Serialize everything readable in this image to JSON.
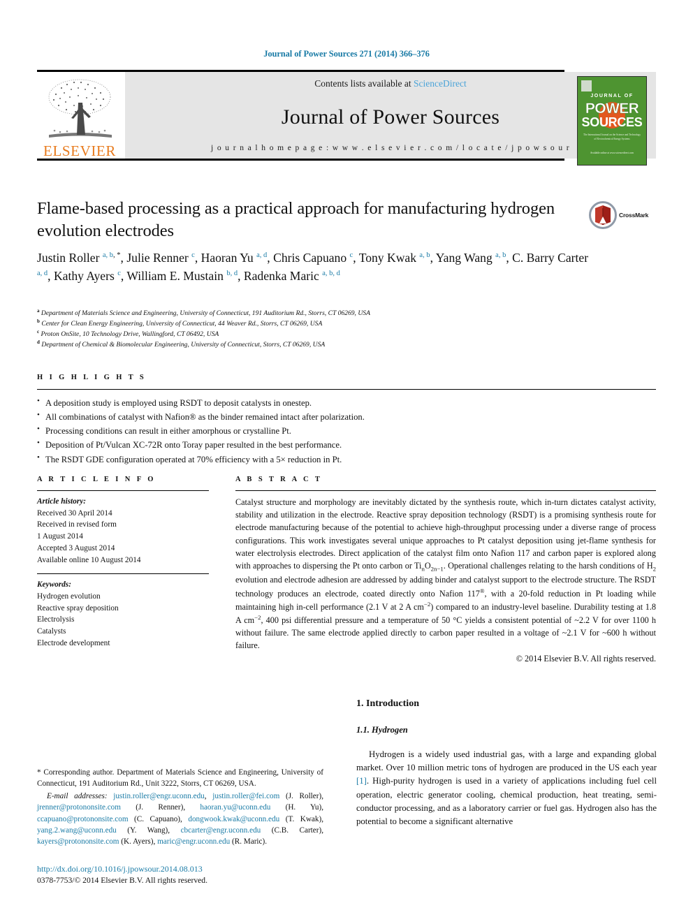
{
  "running_head": "Journal of Power Sources 271 (2014) 366–376",
  "masthead": {
    "contents_prefix": "Contents lists available at ",
    "sciencedirect": "ScienceDirect",
    "journal_title": "Journal of Power Sources",
    "homepage": "j o u r n a l   h o m e p a g e :   w w w . e l s e v i e r . c o m / l o c a t e / j p o w s o u r",
    "elsevier_wordmark": "ELSEVIER",
    "cover": {
      "journal_of": "JOURNAL OF",
      "power": "POWER",
      "sources": "SOURCES",
      "blurb": "The International Journal on the Science and Technology of Electrochemical Energy Systems",
      "editors": "Available online at www.sciencedirect.com"
    },
    "colors": {
      "link_blue": "#4aa3d8",
      "elsevier_orange": "#E87B1E",
      "cover_green": "#4e9431",
      "cover_orange": "#e2571f",
      "box_gray": "#e5e5e5"
    }
  },
  "article": {
    "title": "Flame-based processing as a practical approach for manufacturing hydrogen evolution electrodes",
    "crossmark_label": "CrossMark",
    "authors_html": "Justin Roller <sup>a, b</sup><sup class=\"star\">, *</sup>, Julie Renner <sup>c</sup>, Haoran Yu <sup>a, d</sup>, Chris Capuano <sup>c</sup>, Tony Kwak <sup>a, b</sup>, Yang Wang <sup>a, b</sup>, C. Barry Carter <sup>a, d</sup>, Kathy Ayers <sup>c</sup>, William E. Mustain <sup>b, d</sup>, Radenka Maric <sup>a, b, d</sup>",
    "affiliations": [
      {
        "marker": "a",
        "text": "Department of Materials Science and Engineering, University of Connecticut, 191 Auditorium Rd., Storrs, CT 06269, USA"
      },
      {
        "marker": "b",
        "text": "Center for Clean Energy Engineering, University of Connecticut, 44 Weaver Rd., Storrs, CT 06269, USA"
      },
      {
        "marker": "c",
        "text": "Proton OnSite, 10 Technology Drive, Wallingford, CT 06492, USA"
      },
      {
        "marker": "d",
        "text": "Department of Chemical & Biomolecular Engineering, University of Connecticut, Storrs, CT 06269, USA"
      }
    ]
  },
  "highlights": {
    "heading": "H I G H L I G H T S",
    "items": [
      "A deposition study is employed using RSDT to deposit catalysts in onestep.",
      "All combinations of catalyst with Nafion® as the binder remained intact after polarization.",
      "Processing conditions can result in either amorphous or crystalline Pt.",
      "Deposition of Pt/Vulcan XC-72R onto Toray paper resulted in the best performance.",
      "The RSDT GDE configuration operated at 70% efficiency with a 5× reduction in Pt."
    ]
  },
  "article_info": {
    "heading": "A R T I C L E   I N F O",
    "history_label": "Article history:",
    "history": [
      "Received 30 April 2014",
      "Received in revised form",
      "1 August 2014",
      "Accepted 3 August 2014",
      "Available online 10 August 2014"
    ],
    "keywords_label": "Keywords:",
    "keywords": [
      "Hydrogen evolution",
      "Reactive spray deposition",
      "Electrolysis",
      "Catalysts",
      "Electrode development"
    ]
  },
  "abstract": {
    "heading": "A B S T R A C T",
    "body_html": "Catalyst structure and morphology are inevitably dictated by the synthesis route, which in-turn dictates catalyst activity, stability and utilization in the electrode. Reactive spray deposition technology (RSDT) is a promising synthesis route for electrode manufacturing because of the potential to achieve high-throughput processing under a diverse range of process configurations. This work investigates several unique approaches to Pt catalyst deposition using jet-flame synthesis for water electrolysis electrodes. Direct application of the catalyst film onto Nafion 117 and carbon paper is explored along with approaches to dispersing the Pt onto carbon or Ti<sub>n</sub>O<sub>2n&minus;1</sub>. Operational challenges relating to the harsh conditions of H<sub>2</sub> evolution and electrode adhesion are addressed by adding binder and catalyst support to the electrode structure. The RSDT technology produces an electrode, coated directly onto Nafion 117<sup>&reg;</sup>, with a 20-fold reduction in Pt loading while maintaining high in-cell performance (2.1 V at 2 A cm<sup>&minus;2</sup>) compared to an industry-level baseline. Durability testing at 1.8 A cm<sup>&minus;2</sup>, 400 psi differential pressure and a temperature of 50 &deg;C yields a consistent potential of ~2.2 V for over 1100 h without failure. The same electrode applied directly to carbon paper resulted in a voltage of ~2.1 V for ~600 h without failure.",
    "copyright": "© 2014 Elsevier B.V. All rights reserved."
  },
  "footnote": {
    "corresponding_html": "<span class=\"star\">*</span> Corresponding author. Department of Materials Science and Engineering, University of Connecticut, 191 Auditorium Rd., Unit 3222, Storrs, CT 06269, USA.",
    "email_label": "E-mail addresses:",
    "emails_html": "<span class=\"link\">justin.roller@engr.uconn.edu</span>, <span class=\"link\">justin.roller@fei.com</span> (J. Roller), <span class=\"link\">jrenner@protononsite.com</span> (J. Renner), <span class=\"link\">haoran.yu@uconn.edu</span> (H. Yu), <span class=\"link\">ccapuano@protononsite.com</span> (C. Capuano), <span class=\"link\">dongwook.kwak@uconn.edu</span> (T. Kwak), <span class=\"link\">yang.2.wang@uconn.edu</span> (Y. Wang), <span class=\"link\">cbcarter@engr.uconn.edu</span> (C.B. Carter), <span class=\"link\">kayers@protononsite.com</span> (K. Ayers), <span class=\"link\">maric@engr.uconn.edu</span> (R. Maric).",
    "doi": "http://dx.doi.org/10.1016/j.jpowsour.2014.08.013",
    "issn": "0378-7753/© 2014 Elsevier B.V. All rights reserved."
  },
  "introduction": {
    "section_number_title": "1.  Introduction",
    "subsection": "1.1.  Hydrogen",
    "paragraph_html": "Hydrogen is a widely used industrial gas, with a large and expanding global market. Over 10 million metric tons of hydrogen are produced in the US each year <span class=\"link\">[1]</span>. High-purity hydrogen is used in a variety of applications including fuel cell operation, electric generator cooling, chemical production, heat treating, semi-conductor processing, and as a laboratory carrier or fuel gas. Hydrogen also has the potential to become a significant alternative"
  }
}
